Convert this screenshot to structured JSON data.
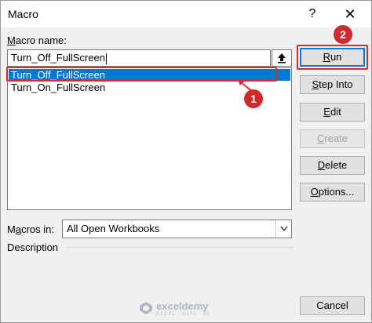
{
  "window": {
    "title": "Macro",
    "help_label": "?",
    "close_label": "✕"
  },
  "macro_name": {
    "label": "Macro name:",
    "value": "Turn_Off_FullScreen"
  },
  "macro_list": {
    "items": [
      {
        "label": "Turn_Off_FullScreen",
        "selected": true
      },
      {
        "label": "Turn_On_FullScreen",
        "selected": false
      }
    ]
  },
  "buttons": {
    "run": "Run",
    "step_into": "Step Into",
    "edit": "Edit",
    "create": "Create",
    "delete": "Delete",
    "options": "Options...",
    "cancel": "Cancel"
  },
  "macros_in": {
    "label": "Macros in:",
    "value": "All Open Workbooks"
  },
  "description": {
    "label": "Description"
  },
  "annotations": {
    "badge_1": "1",
    "badge_2": "2",
    "highlight_color": "#d52b2f"
  },
  "watermark": {
    "name": "exceldemy",
    "tagline": "EXCEL · DATA · BI"
  },
  "colors": {
    "selection": "#0078d7",
    "dialog_bg": "#f0f0f0",
    "badge": "#cf2a2e"
  }
}
